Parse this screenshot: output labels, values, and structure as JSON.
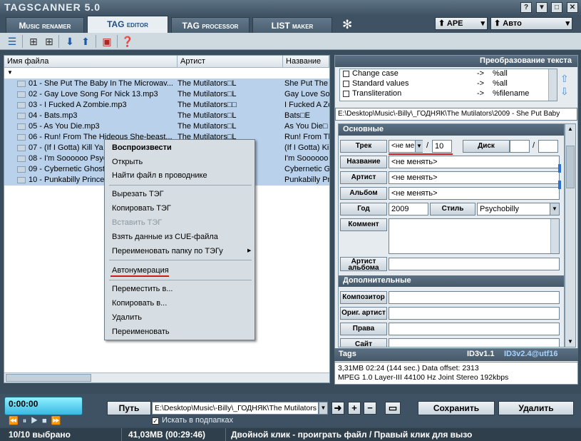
{
  "app": {
    "title": "TAGSCANNER 5.0"
  },
  "window_controls": {
    "help": "?",
    "minimize": "▼",
    "maximize": "□",
    "close": "✕"
  },
  "tabs": [
    {
      "label": "Music renamer"
    },
    {
      "label": "TAG editor"
    },
    {
      "label": "TAG processor"
    },
    {
      "label": "LIST maker"
    }
  ],
  "format_selectors": {
    "tag_format": "APE",
    "mode": "Авто"
  },
  "filelist": {
    "columns": [
      "Имя файла",
      "Артист",
      "Название"
    ],
    "rows": [
      {
        "file": "01 - She Put The Baby In The Microwav...",
        "artist": "The Mutilators□L",
        "title": "She Put The B"
      },
      {
        "file": "02 - Gay Love Song For Nick 13.mp3",
        "artist": "The Mutilators□L",
        "title": "Gay Love Song"
      },
      {
        "file": "03 - I Fucked A Zombie.mp3",
        "artist": "The Mutilators□□",
        "title": "I Fucked A Zo"
      },
      {
        "file": "04 - Bats.mp3",
        "artist": "The Mutilators□L",
        "title": "Bats□E"
      },
      {
        "file": "05 - As You Die.mp3",
        "artist": "The Mutilators□L",
        "title": "As You Die□"
      },
      {
        "file": "06 - Run! From The Hideous She-beast...",
        "artist": "The Mutilators□L",
        "title": "Run! From The"
      },
      {
        "file": "07 - (If I Gotta) Kill Ya",
        "artist": "",
        "title": "(If I Gotta) Ki"
      },
      {
        "file": "08 - I'm Soooooo Psyc",
        "artist": "",
        "title": "I'm Soooooo P"
      },
      {
        "file": "09 - Cybernetic Ghost",
        "artist": "",
        "title": "Cybernetic Gh"
      },
      {
        "file": "10 - Punkabilly Princes",
        "artist": "",
        "title": "Punkabilly Prin"
      }
    ]
  },
  "context_menu": {
    "play": "Воспроизвести",
    "open": "Открыть",
    "find_in_explorer": "Найти файл в проводнике",
    "cut_tag": "Вырезать ТЭГ",
    "copy_tag": "Копировать ТЭГ",
    "paste_tag": "Вставить ТЭГ",
    "cue_data": "Взять данные из CUE-файла",
    "rename_folder": "Переименовать папку по ТЭГу",
    "autonumber": "Автонумерация",
    "move_to": "Переместить в...",
    "copy_to": "Копировать в...",
    "delete": "Удалить",
    "rename": "Переименовать"
  },
  "text_transform": {
    "header": "Преобразование текста",
    "items": [
      {
        "label": "Change case",
        "arrow": "->",
        "target": "%all"
      },
      {
        "label": "Standard values",
        "arrow": "->",
        "target": "%all"
      },
      {
        "label": "Transliteration",
        "arrow": "->",
        "target": "%filename"
      }
    ]
  },
  "path_display": "E:\\Desktop\\Music\\-Billy\\_ГОДНЯК\\The Mutilators\\2009 - She Put Baby",
  "basic": {
    "header": "Основные",
    "track_label": "Трек",
    "track_value": "<не ме",
    "track_slash": "/",
    "track_total": "10",
    "disc_label": "Диск",
    "disc_slash": "/",
    "title_label": "Название",
    "title_value": "<не менять>",
    "artist_label": "Артист",
    "artist_value": "<не менять>",
    "album_label": "Альбом",
    "album_value": "<не менять>",
    "year_label": "Год",
    "year_value": "2009",
    "genre_label": "Стиль",
    "genre_value": "Psychobilly",
    "comment_label": "Коммент",
    "album_artist_label": "Артист альбома"
  },
  "extra": {
    "header": "Дополнительные",
    "composer_label": "Композитор",
    "orig_artist_label": "Ориг. артист",
    "rights_label": "Права",
    "site_label": "Сайт"
  },
  "tags_info": {
    "header": "Tags",
    "v1": "ID3v1.1",
    "v2": "ID3v2.4@utf16",
    "line1": "3,31MB 02:24 (144 sec.) Data offset: 2313",
    "line2": "MPEG 1.0  Layer-III  44100 Hz  Joint Stereo  192kbps"
  },
  "player": {
    "time": "0:00:00"
  },
  "path_bar": {
    "label": "Путь",
    "value": "E:\\Desktop\\Music\\-Billy\\_ГОДНЯК\\The Mutilators",
    "subfolders": "Искать в подпапках"
  },
  "actions": {
    "save": "Сохранить",
    "delete": "Удалить"
  },
  "status": {
    "selected": "10/10 выбрано",
    "size": "41,03MB (00:29:46)",
    "hint": "Двойной клик - проиграть файл / Правый клик для вызо"
  },
  "colors": {
    "accent_red": "#d01818",
    "selection": "#b9d1ea",
    "panel_dark": "#3e5263"
  }
}
